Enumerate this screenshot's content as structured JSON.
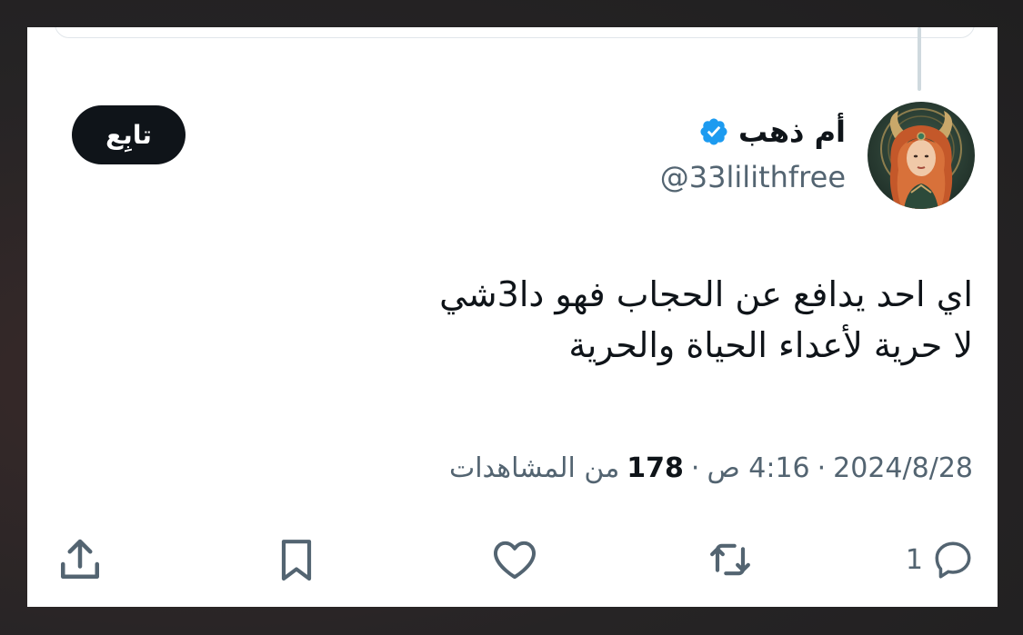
{
  "tweet": {
    "author": {
      "display_name": "أم ذهب",
      "handle": "@33lilithfree",
      "verified": true
    },
    "follow_label": "تابِع",
    "text_lines": [
      "اي احد يدافع عن الحجاب فهو دا3شي",
      "لا حرية لأعداء الحياة والحرية"
    ],
    "meta": {
      "date": "2024/8/28",
      "separator": "·",
      "time": "4:16 ص",
      "views_count": "178",
      "views_label": "من المشاهدات"
    },
    "actions": {
      "reply_count": "1"
    }
  },
  "colors": {
    "text_primary": "#0f1419",
    "text_secondary": "#536471",
    "verified_blue": "#1d9bf0",
    "follow_bg": "#0f1419"
  }
}
